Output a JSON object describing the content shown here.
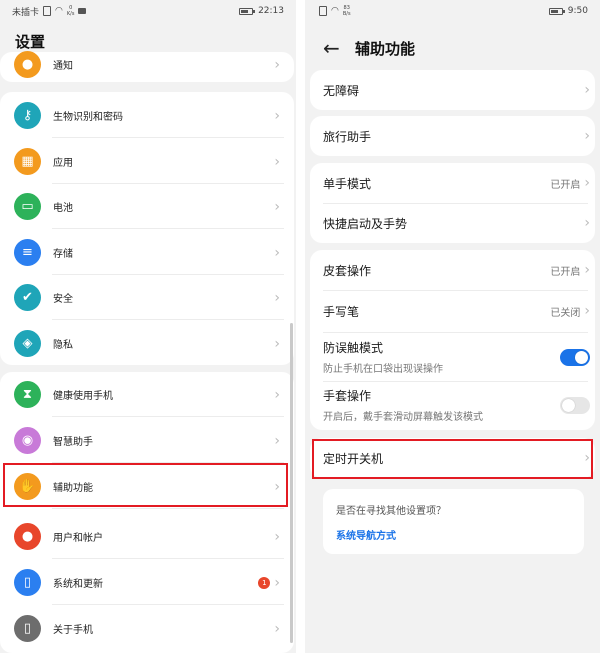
{
  "left": {
    "status": {
      "sim": "未插卡",
      "speed_value": "0",
      "speed_unit": "K/s",
      "time": "22:13"
    },
    "title": "设置",
    "items": [
      {
        "label": "通知",
        "icon": "bell-icon",
        "color": "#f39a1e"
      },
      {
        "label": "生物识别和密码",
        "icon": "key-icon",
        "color": "#1fa5b8"
      },
      {
        "label": "应用",
        "icon": "apps-grid-icon",
        "color": "#f39a1e"
      },
      {
        "label": "电池",
        "icon": "battery-icon",
        "color": "#2db25a"
      },
      {
        "label": "存储",
        "icon": "storage-icon",
        "color": "#2b7ff0"
      },
      {
        "label": "安全",
        "icon": "shield-check-icon",
        "color": "#1fa5b8"
      },
      {
        "label": "隐私",
        "icon": "privacy-shield-icon",
        "color": "#1fa5b8"
      },
      {
        "label": "健康使用手机",
        "icon": "hourglass-icon",
        "color": "#2db25a"
      },
      {
        "label": "智慧助手",
        "icon": "assistant-orb-icon",
        "color": "#c87ad8"
      },
      {
        "label": "辅助功能",
        "icon": "hand-icon",
        "color": "#f39a1e"
      },
      {
        "label": "用户和帐户",
        "icon": "user-icon",
        "color": "#e8462b"
      },
      {
        "label": "系统和更新",
        "icon": "phone-update-icon",
        "color": "#2b7ff0",
        "badge": "1"
      },
      {
        "label": "关于手机",
        "icon": "phone-icon",
        "color": "#6d6d6d"
      }
    ]
  },
  "right": {
    "status": {
      "speed_value": "83",
      "speed_unit": "B/s",
      "time": "9:50"
    },
    "title": "辅助功能",
    "items": [
      {
        "label": "无障碍"
      },
      {
        "label": "旅行助手"
      },
      {
        "label": "单手模式",
        "value": "已开启"
      },
      {
        "label": "快捷启动及手势"
      },
      {
        "label": "皮套操作",
        "value": "已开启"
      },
      {
        "label": "手写笔",
        "value": "已关闭"
      },
      {
        "label": "防误触模式",
        "subtitle": "防止手机在口袋出现误操作",
        "toggle": "on"
      },
      {
        "label": "手套操作",
        "subtitle": "开启后，戴手套滑动屏幕触发该模式",
        "toggle": "off"
      },
      {
        "label": "定时开关机"
      }
    ],
    "suggest": {
      "question": "是否在寻找其他设置项？",
      "link": "系统导航方式"
    }
  },
  "colors": {
    "highlight": "#e31b23",
    "accent": "#1a73e8",
    "background": "#f2f2f2"
  }
}
